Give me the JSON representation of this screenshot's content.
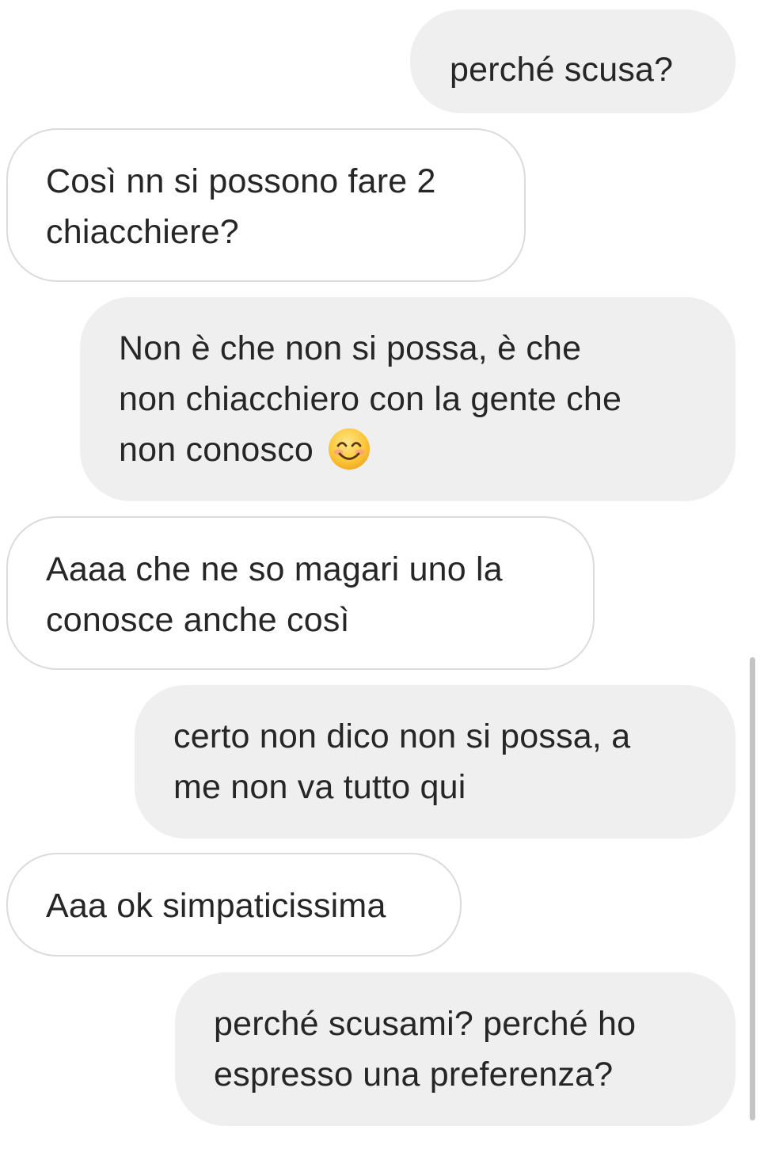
{
  "messages": [
    {
      "direction": "sent",
      "lines": [
        "perché scusa?"
      ]
    },
    {
      "direction": "received",
      "lines": [
        "Così nn si possono fare 2",
        "chiacchiere?"
      ]
    },
    {
      "direction": "sent",
      "lines": [
        "Non è che non si possa, è che",
        "non chiacchiero con la gente che",
        "non conosco"
      ],
      "emoji": "smiling-face-with-smiling-eyes"
    },
    {
      "direction": "received",
      "lines": [
        "Aaaa che ne so magari uno la",
        "conosce anche così"
      ]
    },
    {
      "direction": "sent",
      "lines": [
        "certo non dico non si possa, a",
        "me non va tutto qui"
      ]
    },
    {
      "direction": "received",
      "lines": [
        "Aaa ok simpaticissima"
      ]
    },
    {
      "direction": "sent",
      "lines": [
        "perché scusami? perché ho",
        "espresso una preferenza?"
      ]
    }
  ],
  "colors": {
    "sent_bubble": "#efefef",
    "received_border": "#dbdbdb",
    "text": "#262626"
  }
}
